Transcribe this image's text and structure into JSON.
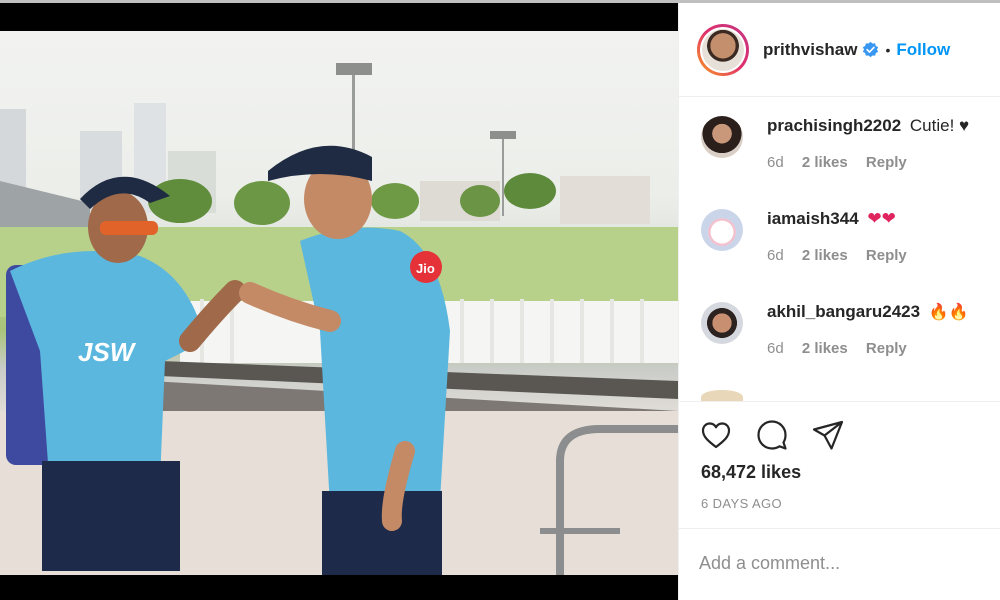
{
  "post": {
    "username": "prithvishaw",
    "verified": true,
    "follow_label": "Follow",
    "separator": "•",
    "image_alt": "Two cricketers in light-blue Delhi Capitals training kits bump fists on a ground"
  },
  "comments": [
    {
      "username": "prachisingh2202",
      "text": "Cutie! ♥",
      "age": "6d",
      "likes": "2 likes",
      "reply": "Reply"
    },
    {
      "username": "iamaish344",
      "text": "❤❤",
      "age": "6d",
      "likes": "2 likes",
      "reply": "Reply"
    },
    {
      "username": "akhil_bangaru2423",
      "text": "🔥🔥",
      "age": "6d",
      "likes": "2 likes",
      "reply": "Reply"
    }
  ],
  "actions": {
    "like_icon": "heart-icon",
    "comment_icon": "comment-icon",
    "share_icon": "share-icon"
  },
  "stats": {
    "likes": "68,472 likes",
    "date": "6 DAYS AGO"
  },
  "comment_box": {
    "placeholder": "Add a comment..."
  },
  "colors": {
    "link": "#0095f6",
    "muted": "#8e8e8e",
    "text": "#262626"
  }
}
